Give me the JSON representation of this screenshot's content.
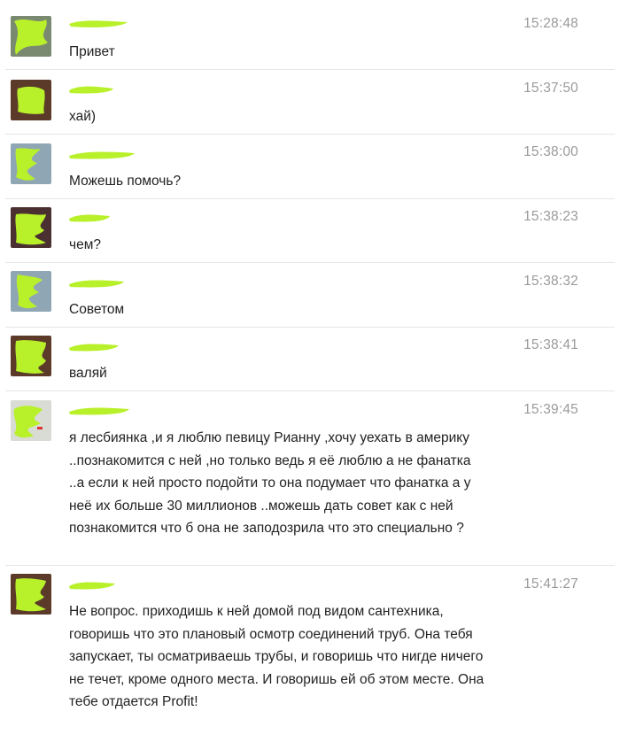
{
  "accent_scribble_color": "#b8f02a",
  "messages": [
    {
      "time": "15:28:48",
      "text": "Привет"
    },
    {
      "time": "15:37:50",
      "text": "хай)"
    },
    {
      "time": "15:38:00",
      "text": "Можешь помочь?"
    },
    {
      "time": "15:38:23",
      "text": "чем?"
    },
    {
      "time": "15:38:32",
      "text": "Советом"
    },
    {
      "time": "15:38:41",
      "text": "валяй"
    },
    {
      "time": "15:39:45",
      "text": "я лесбиянка ,и я люблю певицу Рианну ,хочу уехать в америку ..познакомится с ней ,но только ведь я её люблю а не фанатка ..а если к ней просто подойти то она подумает что фанатка а у неё их больше 30 миллионов ..можешь дать совет как с ней познакомится что б она не заподозрила что это специально ?"
    },
    {
      "time": "15:41:27",
      "text": "Не вопрос. приходишь к ней домой под видом сантехника, говоришь что это плановый осмотр соединений труб. Она тебя запускает, ты осматриваешь трубы, и говоришь что нигде ничего не течет, кроме одного места. И говоришь ей об этом месте. Она тебе отдается Profit!"
    }
  ]
}
